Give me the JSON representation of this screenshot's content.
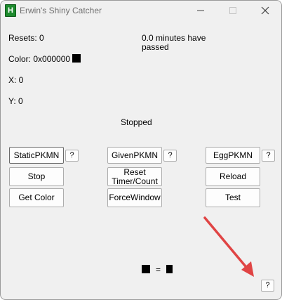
{
  "window": {
    "title": "Erwin's Shiny Catcher",
    "app_icon_letter": "H"
  },
  "status": {
    "resets": "Resets: 0",
    "elapsed_line1": "0.0 minutes have",
    "elapsed_line2": "passed",
    "color": "Color: 0x000000",
    "color_swatch": "#000000",
    "x": "X: 0",
    "y": "Y: 0",
    "state": "Stopped"
  },
  "buttons": {
    "static_pkmn": "StaticPKMN",
    "static_help": "?",
    "given_pkmn": "GivenPKMN",
    "given_help": "?",
    "egg_pkmn": "EggPKMN",
    "egg_help": "?",
    "stop": "Stop",
    "reset_timer": "Reset\nTimer/Count",
    "reload": "Reload",
    "get_color": "Get Color",
    "force_window": "ForceWindow",
    "test": "Test",
    "corner_help": "?"
  },
  "compare": {
    "equals": "=",
    "left_color": "#000000",
    "right_color": "#000000"
  },
  "annotation": {
    "arrow_color": "#e04444"
  }
}
